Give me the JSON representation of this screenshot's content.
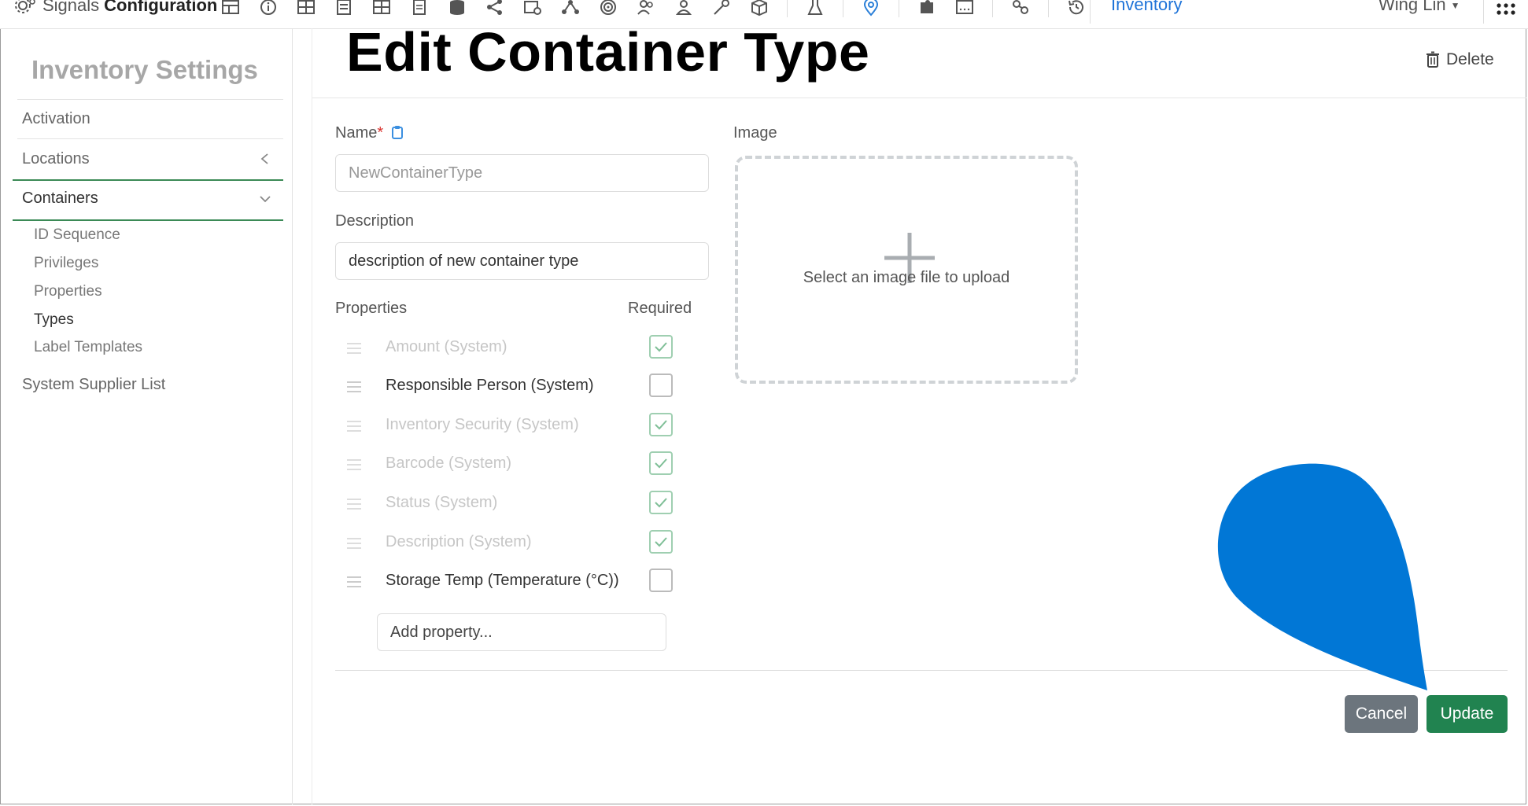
{
  "topbar": {
    "app_prefix": "Signals",
    "app_name": "Configuration",
    "nav_link": "Inventory",
    "user": "Wing Lin",
    "tool_icons": [
      "table-icon",
      "info-icon",
      "grid-icon",
      "document-icon",
      "grid2-icon",
      "page-icon",
      "database-icon",
      "share-icon",
      "link-icon",
      "network-icon",
      "fingerprint-icon",
      "users-icon",
      "user-icon",
      "key-icon",
      "box-icon",
      "flask-icon",
      "location-pin-icon",
      "puzzle-icon",
      "barcode-icon",
      "hierarchy-icon",
      "history-icon"
    ]
  },
  "sidebar": {
    "title": "Inventory Settings",
    "items": [
      {
        "label": "Activation"
      },
      {
        "label": "Locations"
      },
      {
        "label": "Containers"
      },
      {
        "label": "System Supplier List"
      }
    ],
    "sub_items": [
      "ID Sequence",
      "Privileges",
      "Properties",
      "Types",
      "Label Templates"
    ],
    "current_sub": "Types"
  },
  "page": {
    "title": "Edit Container Type",
    "delete_label": "Delete"
  },
  "form": {
    "name_label": "Name",
    "name_required_mark": "*",
    "name_placeholder": "NewContainerType",
    "description_label": "Description",
    "description_value": "description of new container type",
    "properties_label": "Properties",
    "required_label": "Required",
    "properties": [
      {
        "name": "Amount (System)",
        "enabled": false,
        "required": true
      },
      {
        "name": "Responsible Person (System)",
        "enabled": true,
        "required": false
      },
      {
        "name": "Inventory Security (System)",
        "enabled": false,
        "required": true
      },
      {
        "name": "Barcode (System)",
        "enabled": false,
        "required": true
      },
      {
        "name": "Status (System)",
        "enabled": false,
        "required": true
      },
      {
        "name": "Description (System)",
        "enabled": false,
        "required": true
      },
      {
        "name": "Storage Temp (Temperature (°C))",
        "enabled": true,
        "required": false
      }
    ],
    "add_property_placeholder": "Add property...",
    "image_label": "Image",
    "upload_text": "Select an image file to upload"
  },
  "actions": {
    "cancel_label": "Cancel",
    "update_label": "Update"
  },
  "colors": {
    "accent_green": "#218350",
    "link_blue": "#1e73d8",
    "cancel_gray": "#6c757d",
    "overlay_blue": "#0177d6"
  }
}
